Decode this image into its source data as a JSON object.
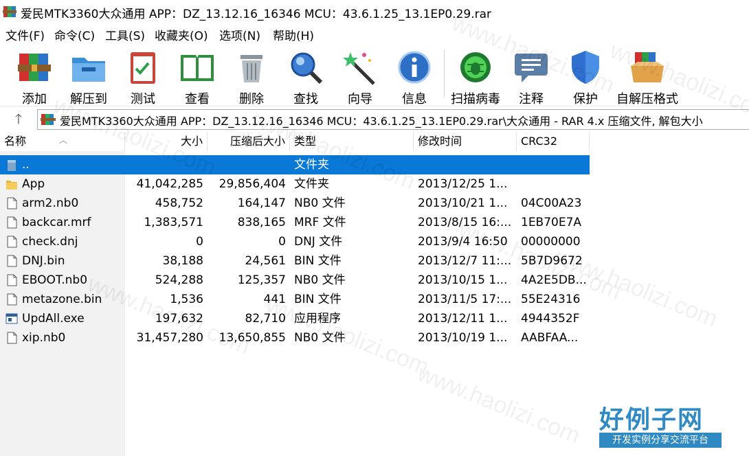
{
  "window": {
    "title": "爱民MTK3360大众通用 APP：DZ_13.12.16_16346 MCU：43.6.1.25_13.1EP0.29.rar"
  },
  "menu": [
    {
      "label": "文件(F)"
    },
    {
      "label": "命令(C)"
    },
    {
      "label": "工具(S)"
    },
    {
      "label": "收藏夹(O)"
    },
    {
      "label": "选项(N)"
    },
    {
      "label": "帮助(H)"
    }
  ],
  "toolbar": [
    {
      "label": "添加",
      "icon": "books-add-icon"
    },
    {
      "label": "解压到",
      "icon": "folder-extract-icon"
    },
    {
      "label": "测试",
      "icon": "clipboard-check-icon"
    },
    {
      "label": "查看",
      "icon": "book-view-icon"
    },
    {
      "label": "删除",
      "icon": "trash-icon"
    },
    {
      "label": "查找",
      "icon": "magnifier-icon"
    },
    {
      "label": "向导",
      "icon": "magic-wand-icon"
    },
    {
      "label": "信息",
      "icon": "info-icon"
    },
    {
      "label": "扫描病毒",
      "icon": "virus-scan-icon"
    },
    {
      "label": "注释",
      "icon": "comment-icon"
    },
    {
      "label": "保护",
      "icon": "shield-icon"
    },
    {
      "label": "自解压格式",
      "icon": "sfx-box-icon"
    }
  ],
  "address": {
    "path": "爱民MTK3360大众通用 APP：DZ_13.12.16_16346 MCU：43.6.1.25_13.1EP0.29.rar\\大众通用 - RAR 4.x 压缩文件, 解包大小"
  },
  "columns": {
    "name": "名称",
    "size": "大小",
    "packed": "压缩后大小",
    "type": "类型",
    "modified": "修改时间",
    "crc": "CRC32"
  },
  "files": [
    {
      "name": "..",
      "size": "",
      "packed": "",
      "type": "文件夹",
      "modified": "",
      "crc": "",
      "icon": "parent-folder-icon",
      "selected": true
    },
    {
      "name": "App",
      "size": "41,042,285",
      "packed": "29,856,404",
      "type": "文件夹",
      "modified": "2013/12/25 1...",
      "crc": "",
      "icon": "folder-icon"
    },
    {
      "name": "arm2.nb0",
      "size": "458,752",
      "packed": "164,147",
      "type": "NB0 文件",
      "modified": "2013/10/21 1...",
      "crc": "04C00A23",
      "icon": "file-icon"
    },
    {
      "name": "backcar.mrf",
      "size": "1,383,571",
      "packed": "838,165",
      "type": "MRF 文件",
      "modified": "2013/8/15 16:...",
      "crc": "1EB70E7A",
      "icon": "file-icon"
    },
    {
      "name": "check.dnj",
      "size": "0",
      "packed": "0",
      "type": "DNJ 文件",
      "modified": "2013/9/4 16:50",
      "crc": "00000000",
      "icon": "file-icon"
    },
    {
      "name": "DNJ.bin",
      "size": "38,188",
      "packed": "24,561",
      "type": "BIN 文件",
      "modified": "2013/12/7 11:...",
      "crc": "5B7D9672",
      "icon": "file-icon"
    },
    {
      "name": "EBOOT.nb0",
      "size": "524,288",
      "packed": "125,357",
      "type": "NB0 文件",
      "modified": "2013/10/15 1...",
      "crc": "4A2E5DB...",
      "icon": "file-icon"
    },
    {
      "name": "metazone.bin",
      "size": "1,536",
      "packed": "441",
      "type": "BIN 文件",
      "modified": "2013/11/5 17:...",
      "crc": "55E24316",
      "icon": "file-icon"
    },
    {
      "name": "UpdAll.exe",
      "size": "197,632",
      "packed": "82,710",
      "type": "应用程序",
      "modified": "2013/12/11 1...",
      "crc": "4944352F",
      "icon": "exe-icon"
    },
    {
      "name": "xip.nb0",
      "size": "31,457,280",
      "packed": "13,650,855",
      "type": "NB0 文件",
      "modified": "2013/10/19 1...",
      "crc": "AABFAA...",
      "icon": "file-icon"
    }
  ],
  "watermark": {
    "text": "www.haolizi.com",
    "brand": "好例子网",
    "brand_sub": "开发实例分享交流平台"
  },
  "colors": {
    "selection": "#0a78d7",
    "brand": "#2f8ac4"
  }
}
